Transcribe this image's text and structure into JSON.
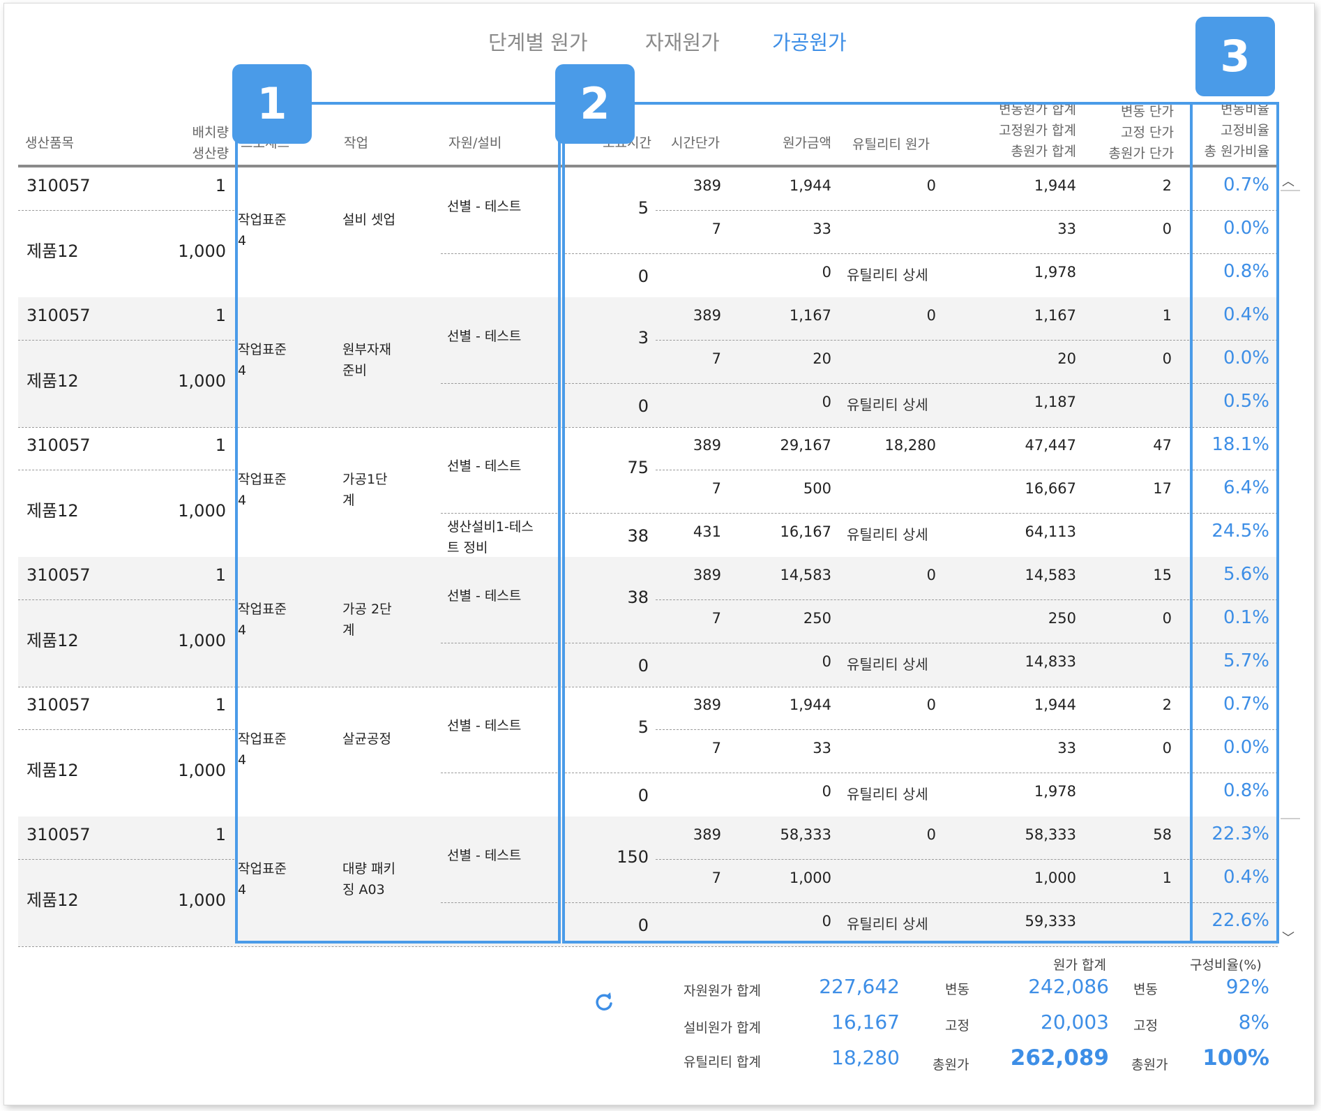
{
  "tabs": {
    "t1": "단계별 원가",
    "t2": "자재원가",
    "t3": "가공원가"
  },
  "headers": {
    "item": "생산품목",
    "batch": "배치량",
    "prodqty": "생산량",
    "process": "프로세스",
    "task": "작업",
    "resource": "자원/설비",
    "reqtime": "소요시간",
    "timeunit": "시간단가",
    "costamt": "원가금액",
    "utilcost": "유틸리티 원가",
    "varsum": "변동원가 합계",
    "fixsum": "고정원가 합계",
    "totsum": "총원가 합계",
    "varunit": "변동 단가",
    "fixunit": "고정 단가",
    "totunit": "총원가 단가",
    "varratio": "변동비율",
    "fixratio": "고정비율",
    "totratio": "총 원가비율"
  },
  "badges": {
    "b1": "1",
    "b2": "2",
    "b3": "3"
  },
  "rows": [
    {
      "code": "310057",
      "batch": "1",
      "name": "제품12",
      "qty": "1,000",
      "process": "작업표준\n4",
      "task": "설비 셋업",
      "res1": "선별 - 테스트",
      "res2": "",
      "time_a": "5",
      "time_b": "0",
      "l1": {
        "tu": "389",
        "amt": "1,944",
        "util": "0",
        "sum": "1,944",
        "unit": "2",
        "pct": "0.7%"
      },
      "l2": {
        "tu": "7",
        "amt": "33",
        "sum": "33",
        "unit": "0",
        "pct": "0.0%"
      },
      "l3": {
        "tu": "",
        "amt": "0",
        "util": "유틸리티 상세",
        "sum": "1,978",
        "unit": "",
        "pct": "0.8%"
      }
    },
    {
      "code": "310057",
      "batch": "1",
      "name": "제품12",
      "qty": "1,000",
      "process": "작업표준\n4",
      "task": "원부자재\n준비",
      "res1": "선별 - 테스트",
      "res2": "",
      "time_a": "3",
      "time_b": "0",
      "l1": {
        "tu": "389",
        "amt": "1,167",
        "util": "0",
        "sum": "1,167",
        "unit": "1",
        "pct": "0.4%"
      },
      "l2": {
        "tu": "7",
        "amt": "20",
        "sum": "20",
        "unit": "0",
        "pct": "0.0%"
      },
      "l3": {
        "tu": "",
        "amt": "0",
        "util": "유틸리티 상세",
        "sum": "1,187",
        "unit": "",
        "pct": "0.5%"
      }
    },
    {
      "code": "310057",
      "batch": "1",
      "name": "제품12",
      "qty": "1,000",
      "process": "작업표준\n4",
      "task": "가공1단\n계",
      "res1": "선별 - 테스트",
      "res2": "생산설비1-테스\n트 정비",
      "time_a": "75",
      "time_b": "38",
      "l1": {
        "tu": "389",
        "amt": "29,167",
        "util": "18,280",
        "sum": "47,447",
        "unit": "47",
        "pct": "18.1%"
      },
      "l2": {
        "tu": "7",
        "amt": "500",
        "sum": "16,667",
        "unit": "17",
        "pct": "6.4%"
      },
      "l3": {
        "tu": "431",
        "amt": "16,167",
        "util": "유틸리티 상세",
        "sum": "64,113",
        "unit": "",
        "pct": "24.5%"
      }
    },
    {
      "code": "310057",
      "batch": "1",
      "name": "제품12",
      "qty": "1,000",
      "process": "작업표준\n4",
      "task": "가공 2단\n계",
      "res1": "선별 - 테스트",
      "res2": "",
      "time_a": "38",
      "time_b": "0",
      "l1": {
        "tu": "389",
        "amt": "14,583",
        "util": "0",
        "sum": "14,583",
        "unit": "15",
        "pct": "5.6%"
      },
      "l2": {
        "tu": "7",
        "amt": "250",
        "sum": "250",
        "unit": "0",
        "pct": "0.1%"
      },
      "l3": {
        "tu": "",
        "amt": "0",
        "util": "유틸리티 상세",
        "sum": "14,833",
        "unit": "",
        "pct": "5.7%"
      }
    },
    {
      "code": "310057",
      "batch": "1",
      "name": "제품12",
      "qty": "1,000",
      "process": "작업표준\n4",
      "task": "살균공정",
      "res1": "선별 - 테스트",
      "res2": "",
      "time_a": "5",
      "time_b": "0",
      "l1": {
        "tu": "389",
        "amt": "1,944",
        "util": "0",
        "sum": "1,944",
        "unit": "2",
        "pct": "0.7%"
      },
      "l2": {
        "tu": "7",
        "amt": "33",
        "sum": "33",
        "unit": "0",
        "pct": "0.0%"
      },
      "l3": {
        "tu": "",
        "amt": "0",
        "util": "유틸리티 상세",
        "sum": "1,978",
        "unit": "",
        "pct": "0.8%"
      }
    },
    {
      "code": "310057",
      "batch": "1",
      "name": "제품12",
      "qty": "1,000",
      "process": "작업표준\n4",
      "task": "대량 패키\n징 A03",
      "res1": "선별 - 테스트",
      "res2": "",
      "time_a": "150",
      "time_b": "0",
      "l1": {
        "tu": "389",
        "amt": "58,333",
        "util": "0",
        "sum": "58,333",
        "unit": "58",
        "pct": "22.3%"
      },
      "l2": {
        "tu": "7",
        "amt": "1,000",
        "sum": "1,000",
        "unit": "1",
        "pct": "0.4%"
      },
      "l3": {
        "tu": "",
        "amt": "0",
        "util": "유틸리티 상세",
        "sum": "59,333",
        "unit": "",
        "pct": "22.6%"
      }
    }
  ],
  "totals": {
    "cost_sum_label": "원가 합계",
    "ratio_label": "구성비율(%)",
    "res_label": "자원원가 합계",
    "res_val": "227,642",
    "eq_label": "설비원가 합계",
    "eq_val": "16,167",
    "util_label": "유틸리티 합계",
    "util_val": "18,280",
    "var_label": "변동",
    "var_val": "242,086",
    "var_ratio_label": "변동",
    "var_ratio": "92%",
    "fix_label": "고정",
    "fix_val": "20,003",
    "fix_ratio_label": "고정",
    "fix_ratio": "8%",
    "tot_label": "총원가",
    "tot_val": "262,089",
    "tot_ratio_label": "총원가",
    "tot_ratio": "100%"
  },
  "icons": {
    "refresh": "refresh-icon",
    "scroll_up": "chevron-up-icon",
    "scroll_down": "chevron-down-icon"
  },
  "colors": {
    "accent": "#3d8ee6",
    "highlight": "#4a9be8",
    "stripe": "#f3f3f3"
  }
}
